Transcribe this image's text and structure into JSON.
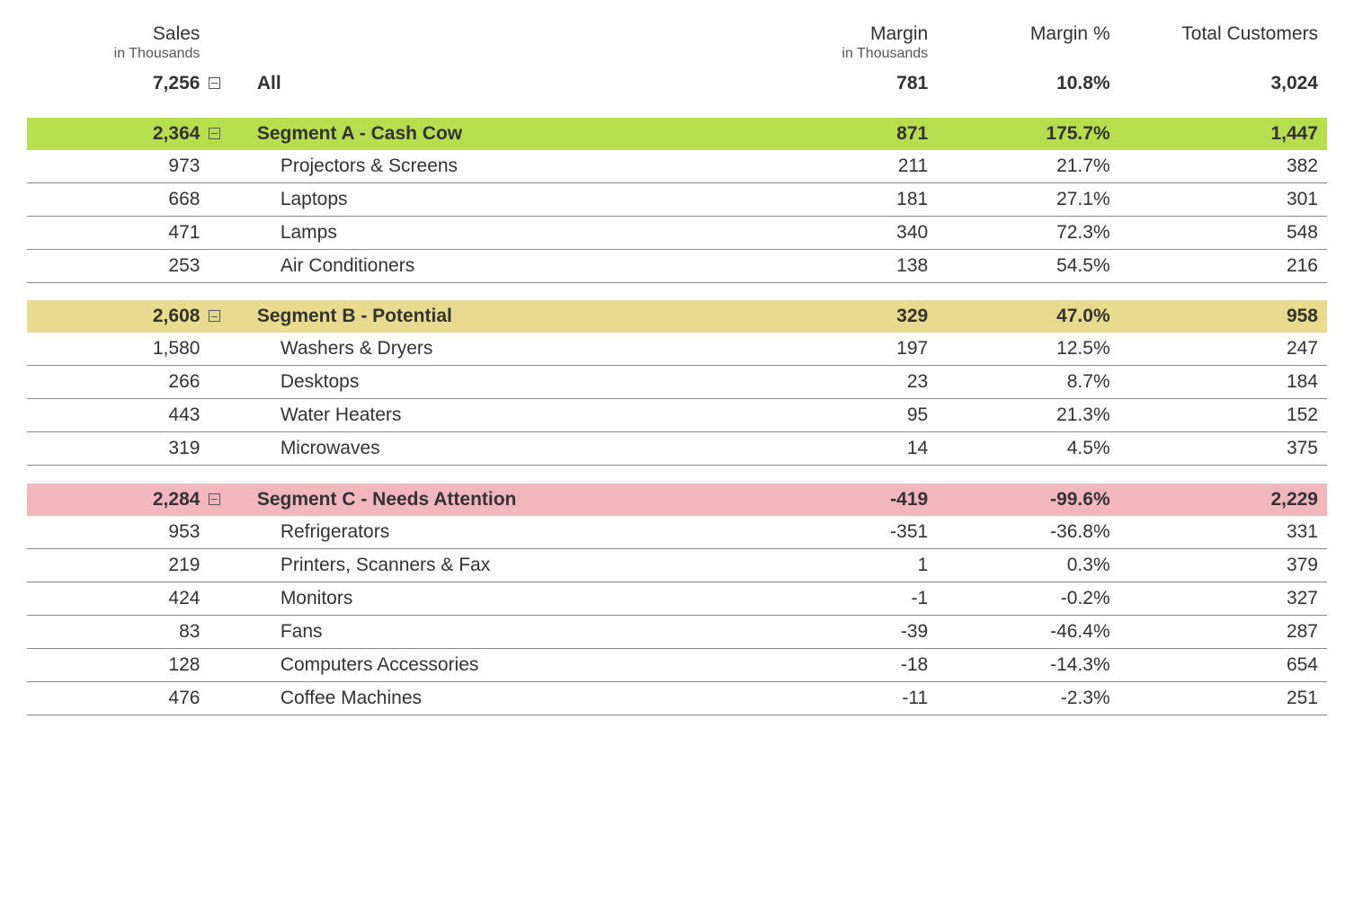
{
  "headers": {
    "sales": "Sales",
    "sales_sub": "in Thousands",
    "margin": "Margin",
    "margin_sub": "in Thousands",
    "margin_pct": "Margin %",
    "customers": "Total Customers"
  },
  "all": {
    "label": "All",
    "sales": "7,256",
    "margin": "781",
    "margin_pct": "10.8%",
    "customers": "3,024"
  },
  "segments": [
    {
      "class": "seg-a",
      "label": "Segment A - Cash Cow",
      "sales": "2,364",
      "margin": "871",
      "margin_pct": "175.7%",
      "customers": "1,447",
      "items": [
        {
          "label": "Projectors & Screens",
          "sales": "973",
          "margin": "211",
          "margin_pct": "21.7%",
          "customers": "382"
        },
        {
          "label": "Laptops",
          "sales": "668",
          "margin": "181",
          "margin_pct": "27.1%",
          "customers": "301"
        },
        {
          "label": "Lamps",
          "sales": "471",
          "margin": "340",
          "margin_pct": "72.3%",
          "customers": "548"
        },
        {
          "label": "Air Conditioners",
          "sales": "253",
          "margin": "138",
          "margin_pct": "54.5%",
          "customers": "216"
        }
      ]
    },
    {
      "class": "seg-b",
      "label": "Segment B - Potential",
      "sales": "2,608",
      "margin": "329",
      "margin_pct": "47.0%",
      "customers": "958",
      "items": [
        {
          "label": "Washers & Dryers",
          "sales": "1,580",
          "margin": "197",
          "margin_pct": "12.5%",
          "customers": "247"
        },
        {
          "label": "Desktops",
          "sales": "266",
          "margin": "23",
          "margin_pct": "8.7%",
          "customers": "184"
        },
        {
          "label": "Water Heaters",
          "sales": "443",
          "margin": "95",
          "margin_pct": "21.3%",
          "customers": "152"
        },
        {
          "label": "Microwaves",
          "sales": "319",
          "margin": "14",
          "margin_pct": "4.5%",
          "customers": "375"
        }
      ]
    },
    {
      "class": "seg-c",
      "label": "Segment C - Needs Attention",
      "sales": "2,284",
      "margin": "-419",
      "margin_pct": "-99.6%",
      "customers": "2,229",
      "items": [
        {
          "label": "Refrigerators",
          "sales": "953",
          "margin": "-351",
          "margin_pct": "-36.8%",
          "customers": "331"
        },
        {
          "label": "Printers, Scanners & Fax",
          "sales": "219",
          "margin": "1",
          "margin_pct": "0.3%",
          "customers": "379"
        },
        {
          "label": "Monitors",
          "sales": "424",
          "margin": "-1",
          "margin_pct": "-0.2%",
          "customers": "327"
        },
        {
          "label": "Fans",
          "sales": "83",
          "margin": "-39",
          "margin_pct": "-46.4%",
          "customers": "287"
        },
        {
          "label": "Computers Accessories",
          "sales": "128",
          "margin": "-18",
          "margin_pct": "-14.3%",
          "customers": "654"
        },
        {
          "label": "Coffee Machines",
          "sales": "476",
          "margin": "-11",
          "margin_pct": "-2.3%",
          "customers": "251"
        }
      ]
    }
  ]
}
